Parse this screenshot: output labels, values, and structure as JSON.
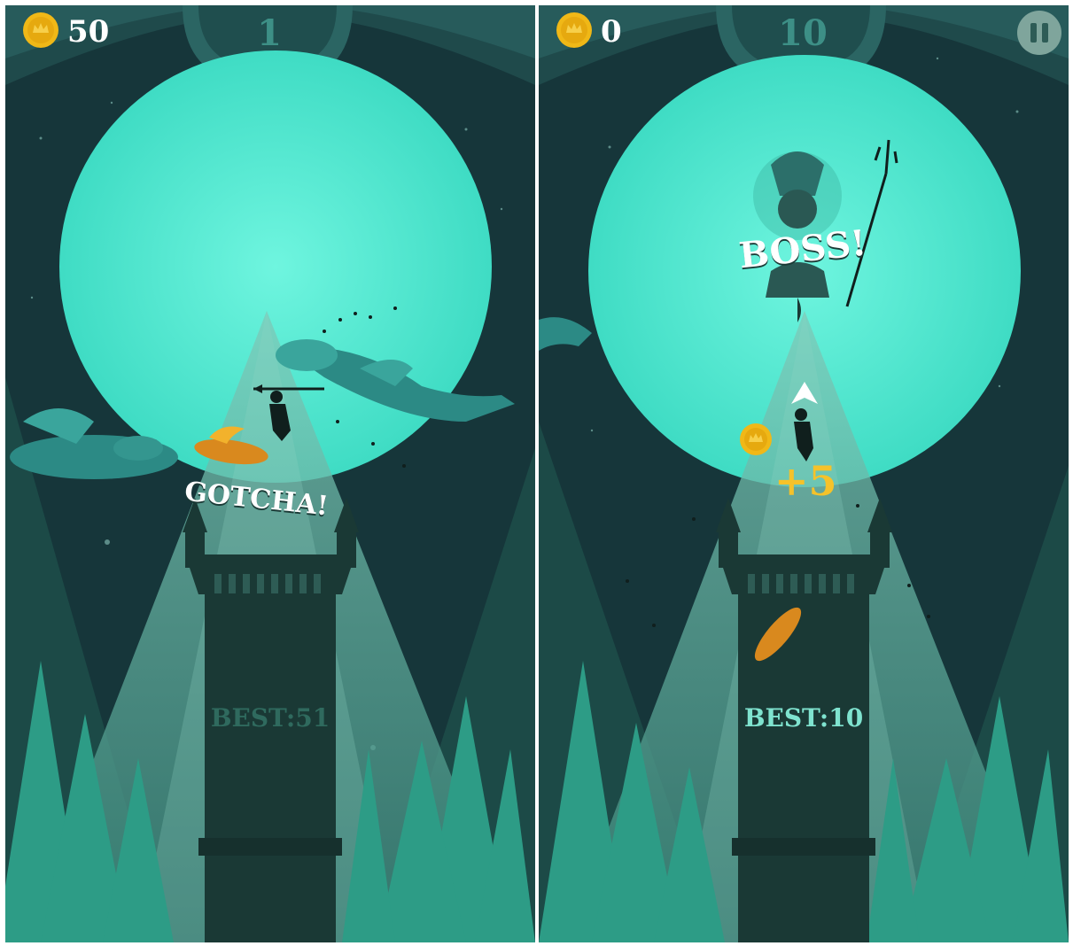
{
  "panels": [
    {
      "coins": "50",
      "score": "1",
      "callout": "GOTCHA!",
      "best": "BEST:51",
      "has_pause": false,
      "icons": [
        "coin-icon",
        "dragon-icon",
        "knight-icon",
        "fireball-icon",
        "tower-icon",
        "moon-icon"
      ]
    },
    {
      "coins": "0",
      "score": "10",
      "callout": "BOSS!",
      "bonus": "+5",
      "best": "BEST:10",
      "has_pause": true,
      "icons": [
        "coin-icon",
        "pause-icon",
        "boss-icon",
        "trident-icon",
        "knight-icon",
        "fireball-icon",
        "tower-icon",
        "moon-icon"
      ]
    }
  ],
  "colors": {
    "sky": "#16363a",
    "moon": "#53f0d7",
    "beam": "#5fb0a0",
    "tower": "#1a3935",
    "coin": "#f0b817",
    "score": "#3d8f86",
    "best_left": "#2f6a5e",
    "best_right": "#7fe3cf",
    "trees": "#2d9c86"
  }
}
